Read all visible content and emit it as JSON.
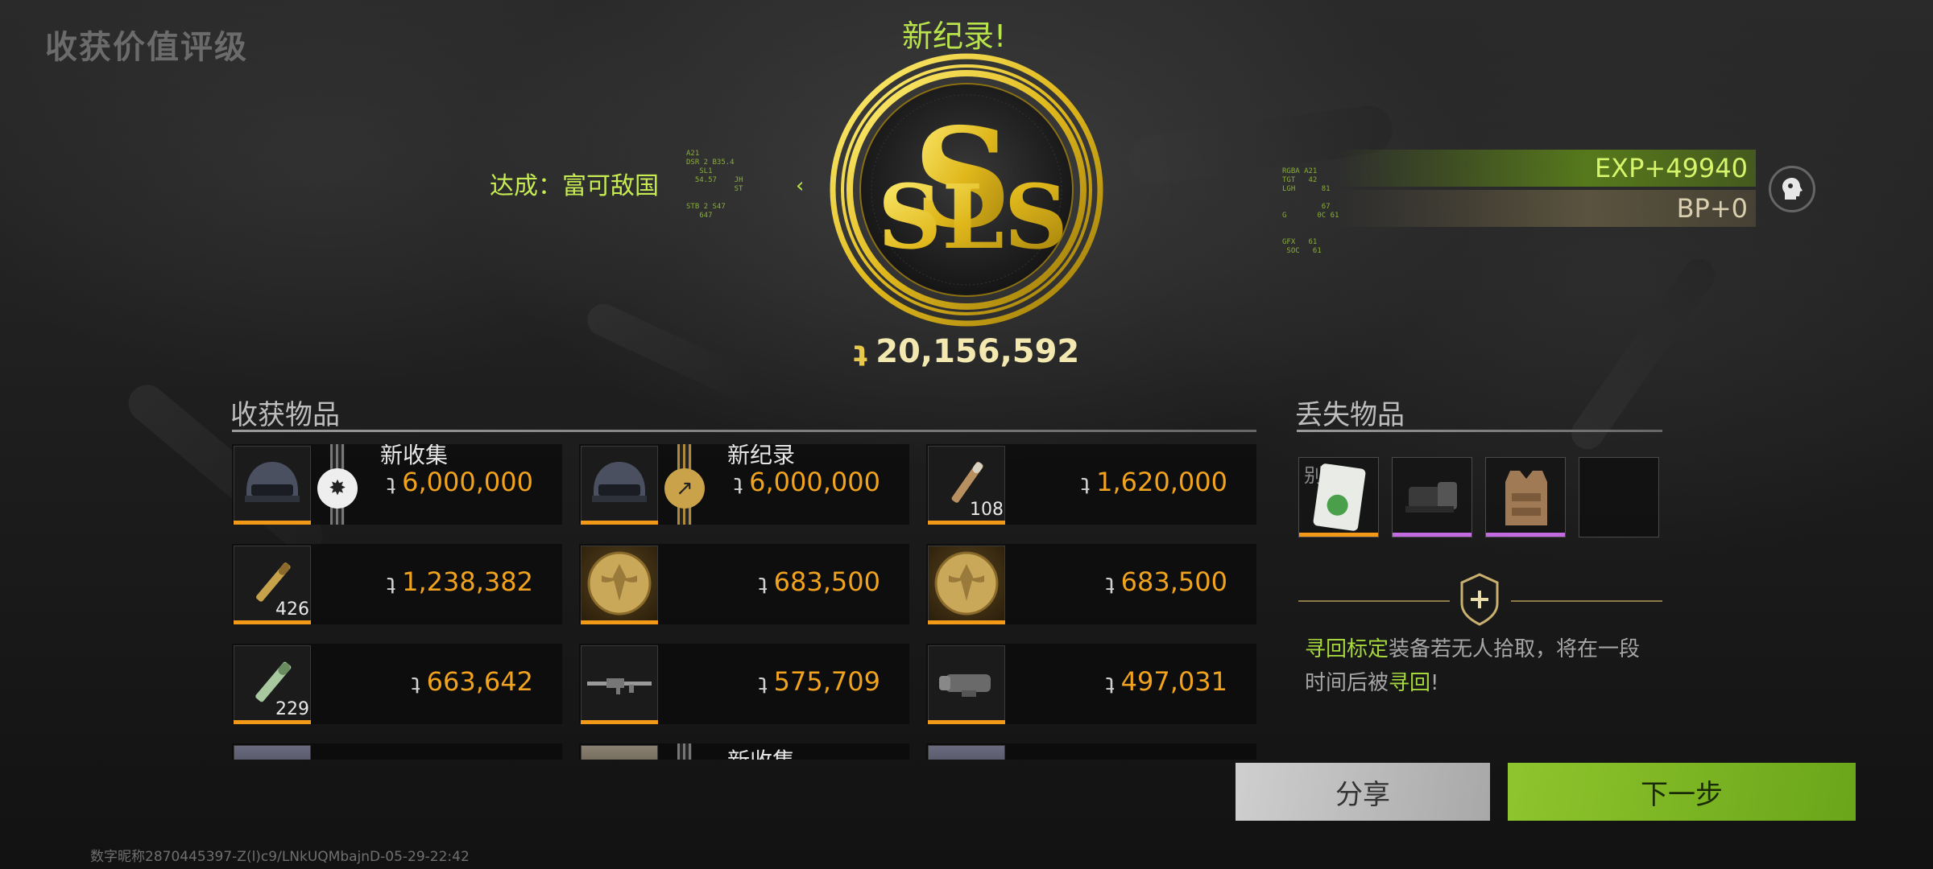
{
  "header": {
    "title": "收获价值评级",
    "record_label": "新纪录!",
    "achievement": "达成：富可敌国",
    "total_value": "20,156,592",
    "currency_symbol": "ʇ"
  },
  "rewards": {
    "exp": "EXP+49940",
    "bp": "BP+0"
  },
  "collected": {
    "title": "收获物品",
    "items": [
      {
        "icon": "helmet-icon",
        "tag": "新收集",
        "badge": "new-collection-badge-icon",
        "price": "6,000,000",
        "qty": "",
        "rarity_color": "#f29a17"
      },
      {
        "icon": "helmet-icon",
        "tag": "新纪录",
        "badge": "new-record-badge-icon",
        "price": "6,000,000",
        "qty": "",
        "rarity_color": "#f29a17"
      },
      {
        "icon": "bullet-icon",
        "tag": "",
        "badge": "",
        "price": "1,620,000",
        "qty": "108",
        "rarity_color": "#f29a17"
      },
      {
        "icon": "bullet-icon",
        "tag": "",
        "badge": "",
        "price": "1,238,382",
        "qty": "426",
        "rarity_color": "#f29a17"
      },
      {
        "icon": "gold-coin-icon",
        "tag": "",
        "badge": "",
        "price": "683,500",
        "qty": "",
        "rarity_color": "#f29a17"
      },
      {
        "icon": "gold-coin-icon",
        "tag": "",
        "badge": "",
        "price": "683,500",
        "qty": "",
        "rarity_color": "#f29a17"
      },
      {
        "icon": "bullet-icon",
        "tag": "",
        "badge": "",
        "price": "663,642",
        "qty": "229",
        "rarity_color": "#f29a17"
      },
      {
        "icon": "rifle-icon",
        "tag": "",
        "badge": "",
        "price": "575,709",
        "qty": "",
        "rarity_color": "#f29a17"
      },
      {
        "icon": "scope-icon",
        "tag": "",
        "badge": "",
        "price": "497,031",
        "qty": "",
        "rarity_color": "#f29a17"
      },
      {
        "icon": "item-icon",
        "tag": "",
        "badge": "",
        "price": "",
        "qty": "",
        "rarity_color": "#f29a17"
      },
      {
        "icon": "item-icon",
        "tag": "新收集",
        "badge": "",
        "price": "",
        "qty": "",
        "rarity_color": "#f29a17"
      },
      {
        "icon": "item-icon",
        "tag": "",
        "badge": "",
        "price": "",
        "qty": "",
        "rarity_color": "#f29a17"
      }
    ]
  },
  "lost": {
    "title": "丢失物品",
    "items": [
      {
        "icon": "keycard-icon",
        "label": "别墅",
        "rarity_color": "#f29a17"
      },
      {
        "icon": "red-dot-sight-icon",
        "label": "",
        "rarity_color": "#c26be0"
      },
      {
        "icon": "vest-icon",
        "label": "",
        "rarity_color": "#c26be0"
      },
      {
        "icon": "empty-slot-icon",
        "label": "",
        "rarity_color": ""
      }
    ],
    "tip_highlight_1": "寻回标定",
    "tip_text_1": "装备若无人拾取，将在一段时间后被",
    "tip_highlight_2": "寻回",
    "tip_text_2": "!"
  },
  "buttons": {
    "share": "分享",
    "next": "下一步"
  },
  "footer": {
    "id_text": "数字昵称2870445397-Z(l)c9/LNkUQMbajnD-05-29-22:42"
  },
  "colors": {
    "accent_green": "#b8e34a",
    "price_orange": "#f2a31d",
    "rarity_orange": "#f29a17",
    "rarity_purple": "#c26be0"
  }
}
